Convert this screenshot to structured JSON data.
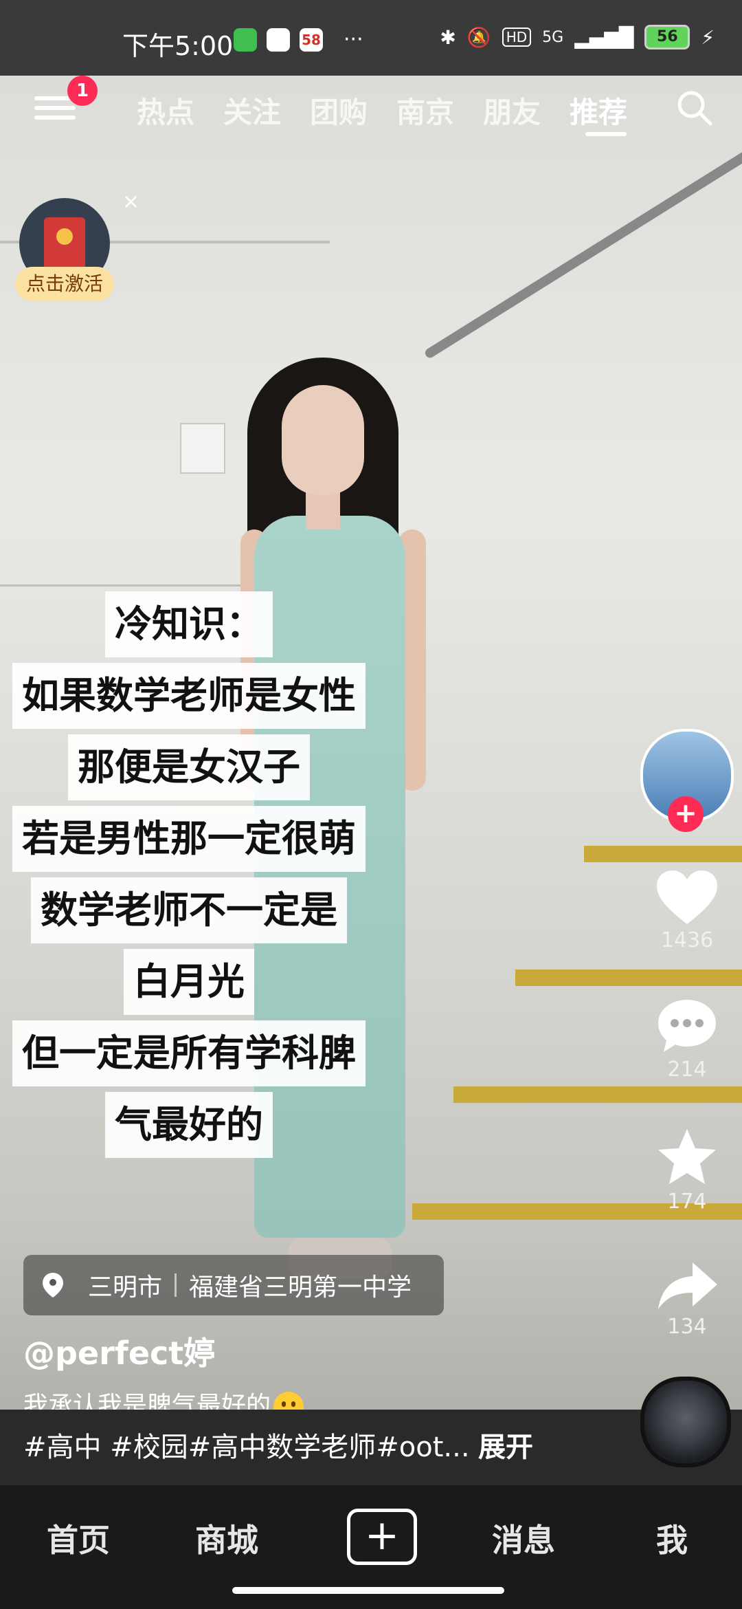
{
  "status_bar": {
    "time": "下午5:00",
    "app_badge_58": "58",
    "more": "···",
    "network": "5G",
    "hd": "HD",
    "battery": "56"
  },
  "top_nav": {
    "notification_badge": "1",
    "tabs": [
      "热点",
      "关注",
      "团购",
      "南京",
      "朋友",
      "推荐"
    ],
    "active_tab": "推荐"
  },
  "promo": {
    "label": "点击激活",
    "close": "×"
  },
  "overlay_text": [
    "冷知识：",
    "如果数学老师是女性",
    "那便是女汉子",
    "若是男性那一定很萌",
    "数学老师不一定是",
    "白月光",
    "但一定是所有学科脾",
    "气最好的"
  ],
  "actions": {
    "likes": "1436",
    "comments": "214",
    "favorites": "174",
    "shares": "134",
    "follow": "+"
  },
  "location": {
    "city": "三明市",
    "place": "福建省三明第一中学"
  },
  "post": {
    "author": "@perfect婷",
    "caption": "我承认我是脾气最好的",
    "hashtags": "#高中 #校园#高中数学老师#oot...",
    "expand": "展开"
  },
  "bottom_nav": {
    "items": [
      "首页",
      "商城",
      "消息",
      "我"
    ],
    "add": "+"
  },
  "colors": {
    "accent": "#fe2c55",
    "battery": "#5fd35a",
    "status_bar": "#3a3a3a",
    "bottom_nav": "#1a1a1a"
  }
}
